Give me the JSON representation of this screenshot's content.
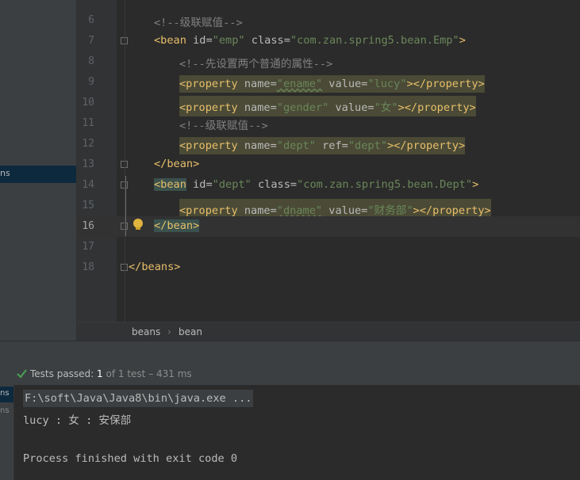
{
  "project_panel": {
    "selected_item": "ns"
  },
  "editor": {
    "lines": [
      {
        "num": "6",
        "comment": "<!--级联赋值-->"
      },
      {
        "num": "7",
        "open": "<bean",
        "a1": "id=",
        "v1": "\"emp\"",
        "a2": "class=",
        "v2": "\"com.zan.spring5.bean.Emp\"",
        "close": ">"
      },
      {
        "num": "8",
        "comment": "<!--先设置两个普通的属性-->"
      },
      {
        "num": "9",
        "open": "<property",
        "a1": "name=",
        "v1": "\"ename\"",
        "a2": "value=",
        "v2": "\"lucy\"",
        "close": "></property>"
      },
      {
        "num": "10",
        "open": "<property",
        "a1": "name=",
        "v1": "\"gender\"",
        "a2": "value=",
        "v2": "\"女\"",
        "close": "></property>"
      },
      {
        "num": "11",
        "comment": "<!--级联赋值-->"
      },
      {
        "num": "12",
        "open": "<property",
        "a1": "name=",
        "v1": "\"dept\"",
        "a2": "ref=",
        "v2": "\"dept\"",
        "close": "></property>"
      },
      {
        "num": "13",
        "tag": "</bean>"
      },
      {
        "num": "14",
        "open": "<bean",
        "a1": "id=",
        "v1": "\"dept\"",
        "a2": "class=",
        "v2": "\"com.zan.spring5.bean.Dept\"",
        "close": ">"
      },
      {
        "num": "15",
        "open": "<property",
        "a1": "name=",
        "v1": "\"dname\"",
        "a2": "value=",
        "v2": "\"财务部\"",
        "close": "></property>"
      },
      {
        "num": "16",
        "tag": "</bean>"
      },
      {
        "num": "17"
      },
      {
        "num": "18",
        "tag": "</beans>"
      }
    ]
  },
  "breadcrumb": {
    "items": [
      "beans",
      "bean"
    ]
  },
  "run": {
    "status_label": "Tests passed:",
    "status_count": "1",
    "status_detail": "of 1 test – 431 ms",
    "side_labels": [
      "ns",
      "ns"
    ],
    "console": {
      "command": "F:\\soft\\Java\\Java8\\bin\\java.exe ...",
      "output": "lucy : 女 : 安保部",
      "exit": "Process finished with exit code 0"
    }
  },
  "colors": {
    "tag": "#e8bf6a",
    "attr": "#bababa",
    "value": "#6a8759",
    "comment": "#808080",
    "success": "#499c54"
  }
}
